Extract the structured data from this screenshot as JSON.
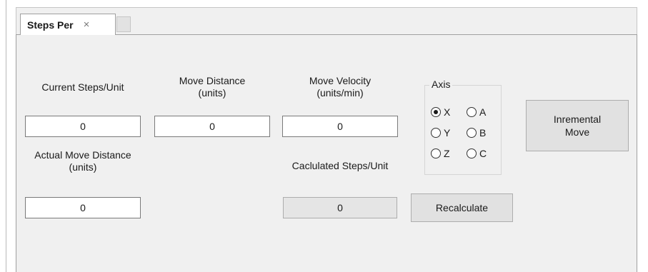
{
  "tabs": {
    "active_label": "Steps Per",
    "close_glyph": "×"
  },
  "labels": {
    "current_steps": "Current Steps/Unit",
    "move_distance_line1": "Move Distance",
    "move_distance_line2": "(units)",
    "move_velocity_line1": "Move Velocity",
    "move_velocity_line2": "(units/min)",
    "actual_move_line1": "Actual Move Distance",
    "actual_move_line2": "(units)",
    "calculated_steps": "Caclulated Steps/Unit"
  },
  "fields": {
    "current_steps_value": "0",
    "move_distance_value": "0",
    "move_velocity_value": "0",
    "actual_move_value": "0",
    "calculated_steps_value": "0"
  },
  "axis": {
    "title": "Axis",
    "selected": "X",
    "options": {
      "x": "X",
      "y": "Y",
      "z": "Z",
      "a": "A",
      "b": "B",
      "c": "C"
    }
  },
  "buttons": {
    "incremental_move_line1": "Inremental",
    "incremental_move_line2": "Move",
    "recalculate": "Recalculate"
  },
  "colors": {
    "panel_bg": "#f0f0f0",
    "button_bg": "#e1e1e1",
    "readonly_bg": "#e5e5e5"
  }
}
